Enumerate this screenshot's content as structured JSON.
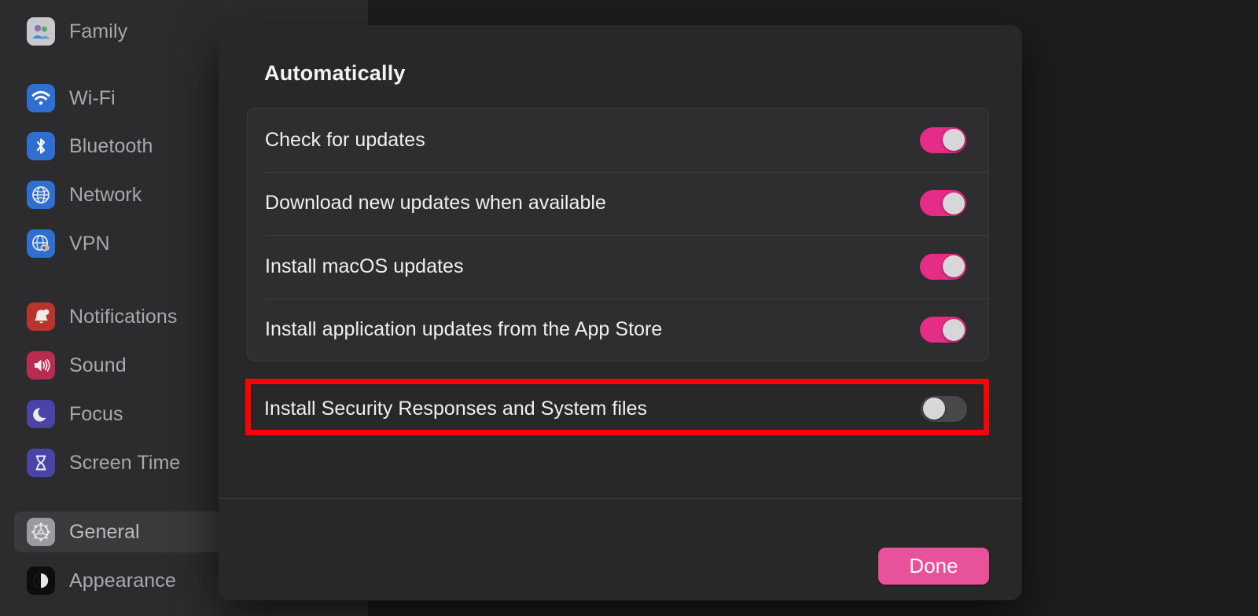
{
  "sidebar": {
    "items": [
      {
        "label": "Family",
        "icon": "family-icon",
        "icon_color": "#c9c9cd",
        "selected": false
      },
      {
        "label": "Wi-Fi",
        "icon": "wifi-icon",
        "icon_color": "#2f6fd0",
        "selected": false
      },
      {
        "label": "Bluetooth",
        "icon": "bluetooth-icon",
        "icon_color": "#2f6fd0",
        "selected": false
      },
      {
        "label": "Network",
        "icon": "network-globe-icon",
        "icon_color": "#2f6fd0",
        "selected": false
      },
      {
        "label": "VPN",
        "icon": "vpn-globe-icon",
        "icon_color": "#2f6fd0",
        "selected": false
      },
      {
        "label": "Notifications",
        "icon": "bell-icon",
        "icon_color": "#b8342c",
        "selected": false
      },
      {
        "label": "Sound",
        "icon": "speaker-icon",
        "icon_color": "#b92b50",
        "selected": false
      },
      {
        "label": "Focus",
        "icon": "moon-icon",
        "icon_color": "#4a43a8",
        "selected": false
      },
      {
        "label": "Screen Time",
        "icon": "hourglass-icon",
        "icon_color": "#4a43a8",
        "selected": false
      },
      {
        "label": "General",
        "icon": "gear-icon",
        "icon_color": "#9a9aa0",
        "selected": true
      },
      {
        "label": "Appearance",
        "icon": "contrast-icon",
        "icon_color": "#0d0d0f",
        "selected": false
      }
    ]
  },
  "dialog": {
    "title": "Automatically",
    "rows": [
      {
        "label": "Check for updates",
        "toggle": "on"
      },
      {
        "label": "Download new updates when available",
        "toggle": "on"
      },
      {
        "label": "Install macOS updates",
        "toggle": "on"
      },
      {
        "label": "Install application updates from the App Store",
        "toggle": "on"
      }
    ],
    "highlighted_row": {
      "label": "Install Security Responses and System files",
      "toggle": "off"
    },
    "done_label": "Done"
  },
  "colors": {
    "toggle_on": "#e52c87",
    "toggle_off": "#48484b",
    "toggle_knob": "#d7d7d9",
    "done_button": "#e8529a",
    "highlight_box": "#fe0000",
    "sheet_background": "#282829",
    "card_background": "#2e2e30",
    "sidebar_background": "#2c2c2e",
    "page_background": "#1d1d1f"
  }
}
